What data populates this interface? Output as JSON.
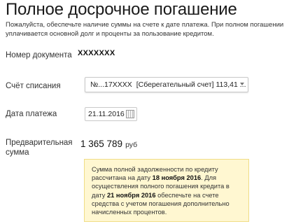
{
  "page": {
    "title": "Полное досрочное погашение",
    "note": "Пожалуйста, обеспечьте наличие суммы на счете к дате платежа. При полном погашении уплачивается основной долг и проценты за пользование кредитом."
  },
  "form": {
    "document_number": {
      "label": "Номер документа",
      "value": "XXXXXXX"
    },
    "debit_account": {
      "label": "Счёт списания",
      "number": "№...17XXXX",
      "description": "[Сберегательный счет] 113,41 ..."
    },
    "payment_date": {
      "label": "Дата платежа",
      "value": "21.11.2016"
    },
    "preliminary_amount": {
      "label_line1": "Предварительная",
      "label_line2": "сумма",
      "value": "1 365 789",
      "currency": "руб"
    }
  },
  "info": {
    "text1": "Сумма полной задолженности по кредиту рассчитана на дату ",
    "date1": "18 ноября 2016",
    "text2": ". Для осуществления полного погашения кредита в дату ",
    "date2": "21 ноября 2016",
    "text3": " обеспечьте на счете средства с учетом погашения дополнительно начисленных процентов."
  },
  "colors": {
    "info_bg": "#fff7d1",
    "info_border": "#f0dd86"
  },
  "icons": {
    "account_dropdown": "chevron-down-icon",
    "date_picker": "calendar-icon"
  }
}
